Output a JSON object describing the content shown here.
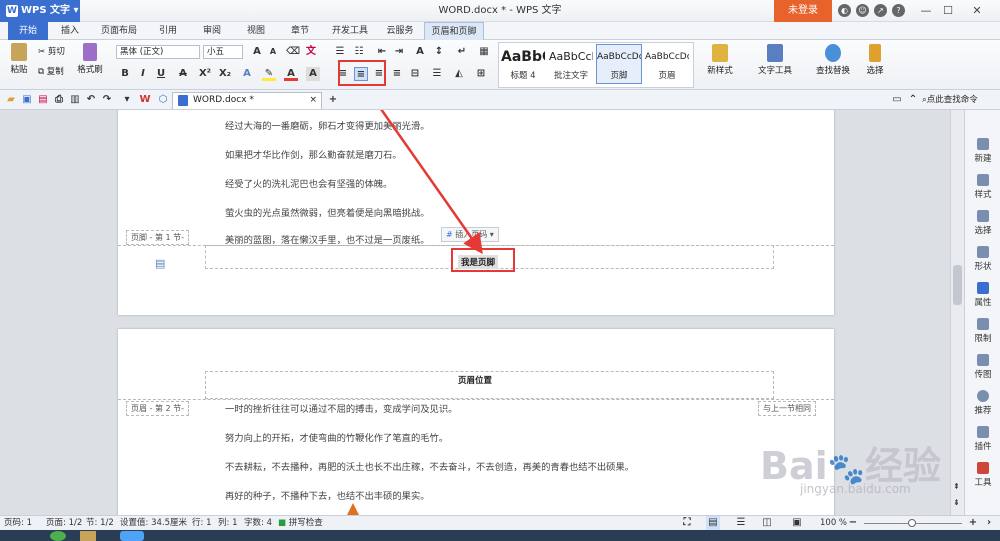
{
  "app": {
    "name": "WPS 文字",
    "window_title": "WORD.docx * - WPS 文字",
    "login_label": "未登录"
  },
  "window_controls": {
    "minimize": "—",
    "maximize": "☐",
    "close": "✕"
  },
  "tabs": [
    "开始",
    "插入",
    "页面布局",
    "引用",
    "审阅",
    "视图",
    "章节",
    "开发工具",
    "云服务",
    "页眉和页脚"
  ],
  "ribbon": {
    "paste": "粘贴",
    "cut": "剪切",
    "copy": "复制",
    "format_painter": "格式刷",
    "font_name": "黑体 (正文)",
    "font_size": "小五",
    "styles": [
      {
        "preview": "AaBbC",
        "label": "标题 4"
      },
      {
        "preview": "AaBbCcI",
        "label": "批注文字"
      },
      {
        "preview": "AaBbCcDc",
        "label": "页脚"
      },
      {
        "preview": "AaBbCcDc",
        "label": "页眉"
      }
    ],
    "new_style": "新样式",
    "text_tools": "文字工具",
    "find_replace": "查找替换",
    "select": "选择"
  },
  "doc_tab": {
    "name": "WORD.docx *",
    "search_label": "点此查找命令"
  },
  "page1": {
    "lines": [
      "经过大海的一番磨砺，卵石才变得更加美丽光滑。",
      "如果把才华比作剑，那么勤奋就是磨刀石。",
      "经受了火的洗礼泥巴也会有坚强的体魄。",
      "萤火虫的光点虽然微弱，但亮着便是向黑暗挑战。",
      "美丽的蓝图，落在懒汉手里，也不过是一页废纸。"
    ],
    "footer_section": "页脚 - 第 1 节-",
    "insert_page_number": "插入页码",
    "footer_text": "我是页脚"
  },
  "page2": {
    "header_position": "页眉位置",
    "header_section": "页眉 - 第 2 节-",
    "same_as_prev": "与上一节相同",
    "lines": [
      "一时的挫折往往可以通过不屈的搏击，变成学问及见识。",
      "努力向上的开拓，才使弯曲的竹鞭化作了笔直的毛竹。",
      "不去耕耘，不去播种，再肥的沃土也长不出庄稼，不去奋斗，不去创造，再美的青春也结不出硕果。",
      "再好的种子，不播种下去，也结不出丰硕的果实。"
    ]
  },
  "right_panel": [
    "新建",
    "样式",
    "选择",
    "形状",
    "属性",
    "限制",
    "传图",
    "推荐",
    "插件",
    "工具"
  ],
  "status": {
    "page": "页码: 1",
    "pages": "页面: 1/2",
    "section": "节: 1/2",
    "setting": "设置值: 34.5厘米",
    "row": "行: 1",
    "col": "列: 1",
    "words": "字数: 4",
    "spell": "拼写检查",
    "zoom": "100 %"
  },
  "watermark": {
    "brand": "Bai",
    "brand2": "经验",
    "url": "jingyan.baidu.com"
  },
  "colors": {
    "accent": "#3a6fd0",
    "login": "#e8622c",
    "annotation": "#e53935"
  }
}
